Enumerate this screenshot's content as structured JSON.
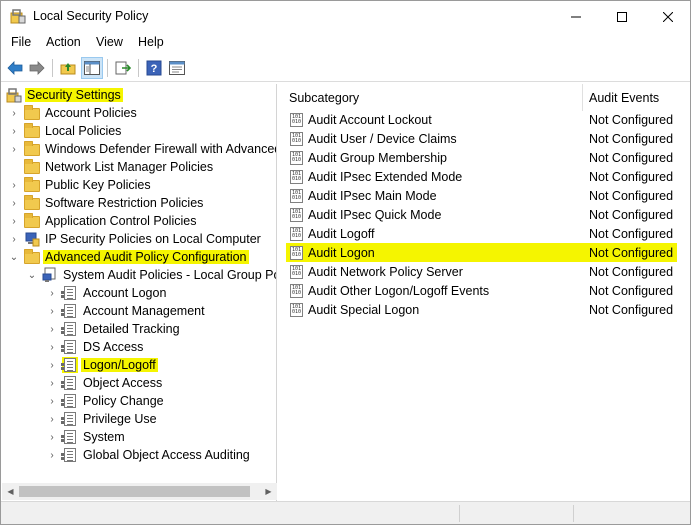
{
  "window": {
    "title": "Local Security Policy"
  },
  "menu": {
    "items": [
      "File",
      "Action",
      "View",
      "Help"
    ]
  },
  "toolbar": {
    "buttons": [
      "back-icon",
      "forward-icon",
      "up-folder-icon",
      "show-hide-tree-icon",
      "export-list-icon",
      "help-icon",
      "properties-icon"
    ]
  },
  "tree": {
    "root": "Security Settings",
    "items": [
      {
        "label": "Account Policies",
        "icon": "folder-icon"
      },
      {
        "label": "Local Policies",
        "icon": "folder-icon"
      },
      {
        "label": "Windows Defender Firewall with Advanced",
        "icon": "folder-icon"
      },
      {
        "label": "Network List Manager Policies",
        "icon": "folder-icon"
      },
      {
        "label": "Public Key Policies",
        "icon": "folder-icon"
      },
      {
        "label": "Software Restriction Policies",
        "icon": "folder-icon"
      },
      {
        "label": "Application Control Policies",
        "icon": "folder-icon"
      },
      {
        "label": "IP Security Policies on Local Computer",
        "icon": "ip-security-icon"
      },
      {
        "label": "Advanced Audit Policy Configuration",
        "icon": "folder-icon"
      },
      {
        "label": "System Audit Policies - Local Group Poli",
        "icon": "computer-policy-icon"
      },
      {
        "label": "Account Logon",
        "icon": "policy-icon"
      },
      {
        "label": "Account Management",
        "icon": "policy-icon"
      },
      {
        "label": "Detailed Tracking",
        "icon": "policy-icon"
      },
      {
        "label": "DS Access",
        "icon": "policy-icon"
      },
      {
        "label": "Logon/Logoff",
        "icon": "policy-icon"
      },
      {
        "label": "Object Access",
        "icon": "policy-icon"
      },
      {
        "label": "Policy Change",
        "icon": "policy-icon"
      },
      {
        "label": "Privilege Use",
        "icon": "policy-icon"
      },
      {
        "label": "System",
        "icon": "policy-icon"
      },
      {
        "label": "Global Object Access Auditing",
        "icon": "policy-icon"
      }
    ]
  },
  "list": {
    "columns": [
      "Subcategory",
      "Audit Events"
    ],
    "rows": [
      {
        "subcategory": "Audit Account Lockout",
        "events": "Not Configured"
      },
      {
        "subcategory": "Audit User / Device Claims",
        "events": "Not Configured"
      },
      {
        "subcategory": "Audit Group Membership",
        "events": "Not Configured"
      },
      {
        "subcategory": "Audit IPsec Extended Mode",
        "events": "Not Configured"
      },
      {
        "subcategory": "Audit IPsec Main Mode",
        "events": "Not Configured"
      },
      {
        "subcategory": "Audit IPsec Quick Mode",
        "events": "Not Configured"
      },
      {
        "subcategory": "Audit Logoff",
        "events": "Not Configured"
      },
      {
        "subcategory": "Audit Logon",
        "events": "Not Configured"
      },
      {
        "subcategory": "Audit Network Policy Server",
        "events": "Not Configured"
      },
      {
        "subcategory": "Audit Other Logon/Logoff Events",
        "events": "Not Configured"
      },
      {
        "subcategory": "Audit Special Logon",
        "events": "Not Configured"
      }
    ]
  },
  "colors": {
    "highlight": "#f5f500",
    "folder": "#f1c94e",
    "nav_arrow": "#2f7ec8"
  }
}
